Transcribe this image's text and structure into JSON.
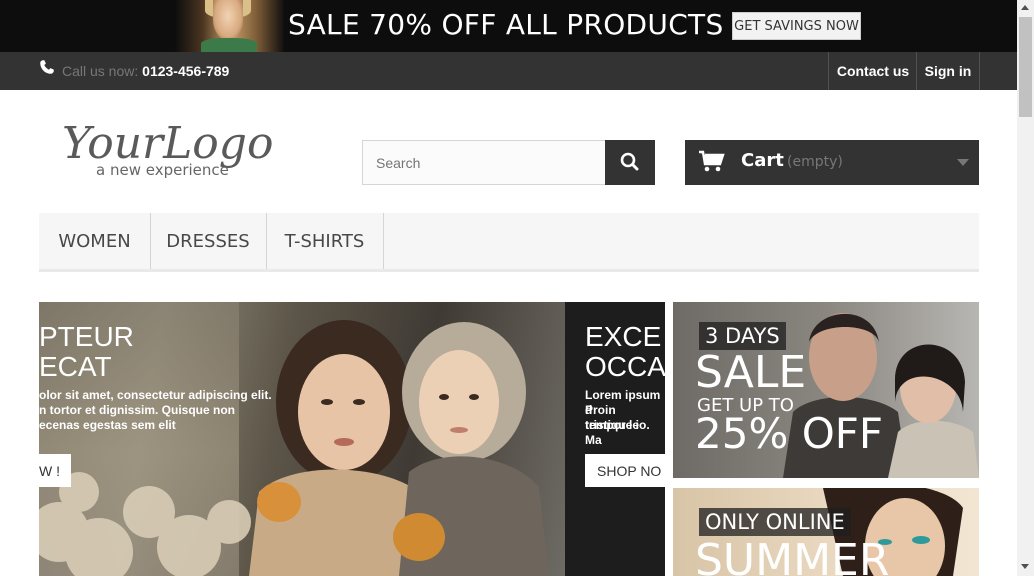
{
  "promo": {
    "title": "SALE 70% OFF ALL PRODUCTS",
    "button": "GET SAVINGS NOW"
  },
  "nav": {
    "call_label": "Call us now:",
    "phone": "0123-456-789",
    "contact": "Contact us",
    "signin": "Sign in"
  },
  "header": {
    "logo_main": "YourLogo",
    "logo_tagline": "a new experience",
    "search_placeholder": "Search",
    "cart_label": "Cart",
    "cart_status": "(empty)"
  },
  "menu": [
    "WOMEN",
    "DRESSES",
    "T-SHIRTS"
  ],
  "slides": [
    {
      "heading_1": "PTEUR",
      "heading_2": "ECAT",
      "text_1": "olor sit amet, consectetur adipiscing elit.",
      "text_2": "n tortor et dignissim. Quisque non",
      "text_3": "ecenas egestas sem elit",
      "button": "W !"
    },
    {
      "heading_1": "EXCE",
      "heading_2": "OCCA",
      "text_1": "Lorem ipsum d",
      "text_2": "Proin tristique i",
      "text_3": "tempor leo. Ma",
      "button": "SHOP NO"
    }
  ],
  "banners": [
    {
      "tag": "3 DAYS",
      "headline": "SALE",
      "sub": "GET UP TO",
      "offer": "25% OFF"
    },
    {
      "tag": "ONLY ONLINE",
      "headline": "SUMMER"
    }
  ],
  "colors": {
    "dark": "#333333",
    "promo_bg": "#0d0d0d",
    "menu_bg": "#f6f6f6"
  }
}
